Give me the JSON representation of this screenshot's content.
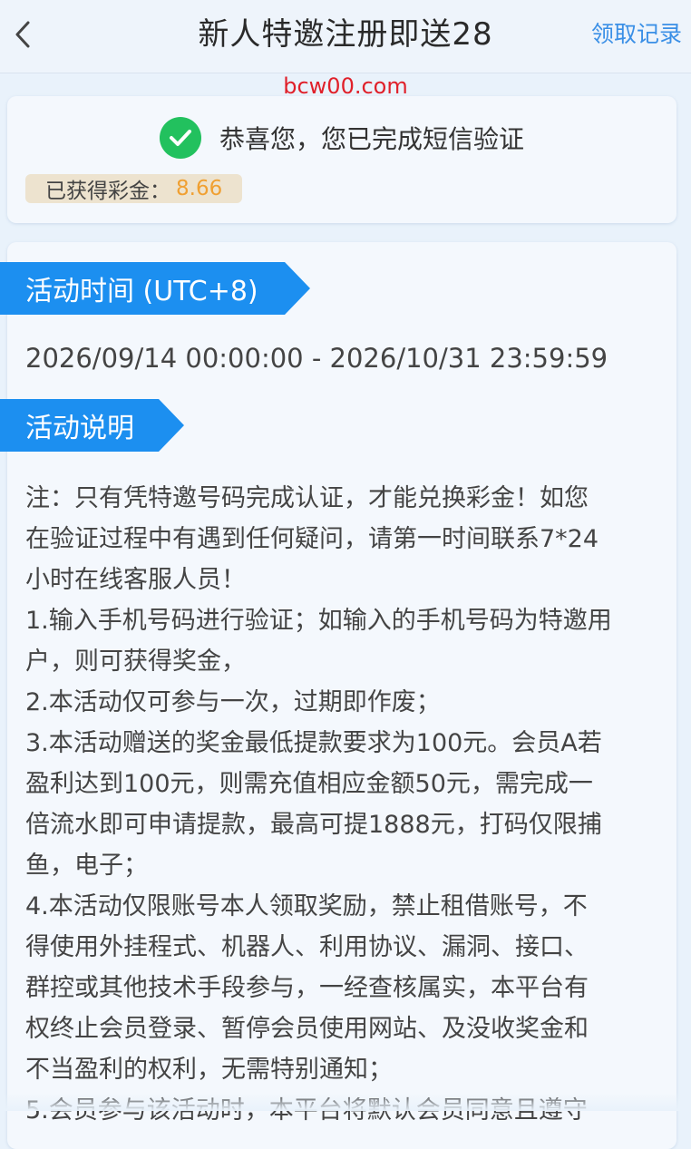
{
  "header": {
    "back_icon": "chevron-left-icon",
    "title": "新人特邀注册即送28",
    "record_link": "领取记录"
  },
  "watermark": "bcw00.com",
  "verify": {
    "icon": "check-circle-icon",
    "message": "恭喜您，您已完成短信验证",
    "prize_label": "已获得彩金：",
    "prize_value": "8.66"
  },
  "activity": {
    "time_title": "活动时间 (UTC+8)",
    "date_range": "2026/09/14 00:00:00 - 2026/10/31 23:59:59",
    "desc_title": "活动说明",
    "desc_lines": [
      "注：只有凭特邀号码完成认证，才能兑换彩金！如您",
      "在验证过程中有遇到任何疑问，请第一时间联系7*24",
      "小时在线客服人员！",
      "1.输入手机号码进行验证；如输入的手机号码为特邀用",
      "户，则可获得奖金，",
      "2.本活动仅可参与一次，过期即作废；",
      "3.本活动赠送的奖金最低提款要求为100元。会员A若",
      "盈利达到100元，则需充值相应金额50元，需完成一",
      "倍流水即可申请提款，最高可提1888元，打码仅限捕",
      "鱼，电子；",
      "4.本活动仅限账号本人领取奖励，禁止租借账号，不",
      "得使用外挂程式、机器人、利用协议、漏洞、接口、",
      "群控或其他技术手段参与，一经查核属实，本平台有",
      "权终止会员登录、暂停会员使用网站、及没收奖金和",
      "不当盈利的权利，无需特别通知；",
      "5.会员参与该活动时，本平台将默认会员同意且遵守"
    ]
  },
  "colors": {
    "accent": "#1c8ff0",
    "link": "#3a8fe6",
    "success": "#22c15e",
    "prize": "#f0a032",
    "watermark": "#e0202a"
  }
}
